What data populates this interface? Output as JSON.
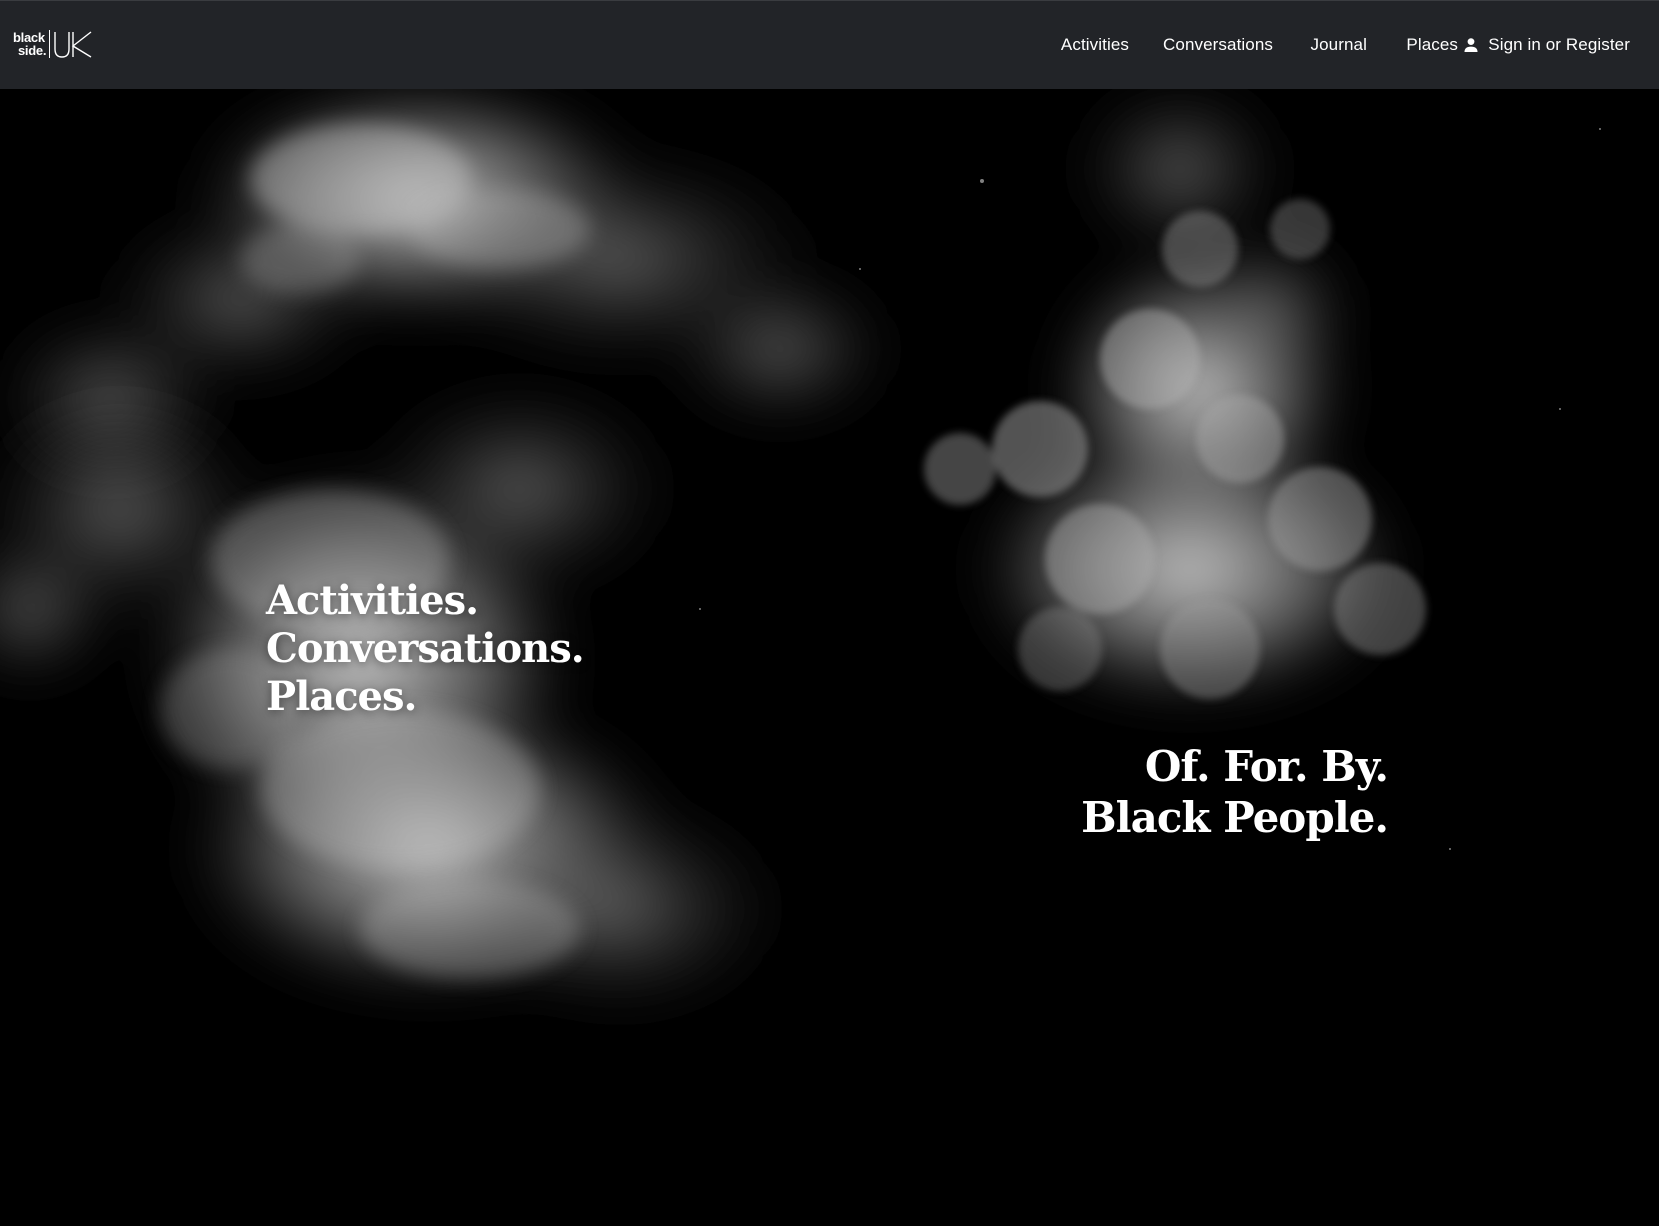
{
  "brand": {
    "logo_line1": "black",
    "logo_line2": "side.",
    "logo_mark": "UK"
  },
  "nav": {
    "items": [
      {
        "label": "Activities"
      },
      {
        "label": "Conversations"
      },
      {
        "label": "Journal"
      },
      {
        "label": "Places"
      }
    ],
    "account_icon": "user-icon",
    "account_label": "Sign in or Register"
  },
  "hero": {
    "left_lines": [
      "Activities.",
      "Conversations.",
      "Places."
    ],
    "right_lines": [
      "Of. For. By.",
      "Black People."
    ]
  },
  "colors": {
    "header_bg": "#222428",
    "hero_bg": "#000000",
    "text": "#ffffff"
  }
}
